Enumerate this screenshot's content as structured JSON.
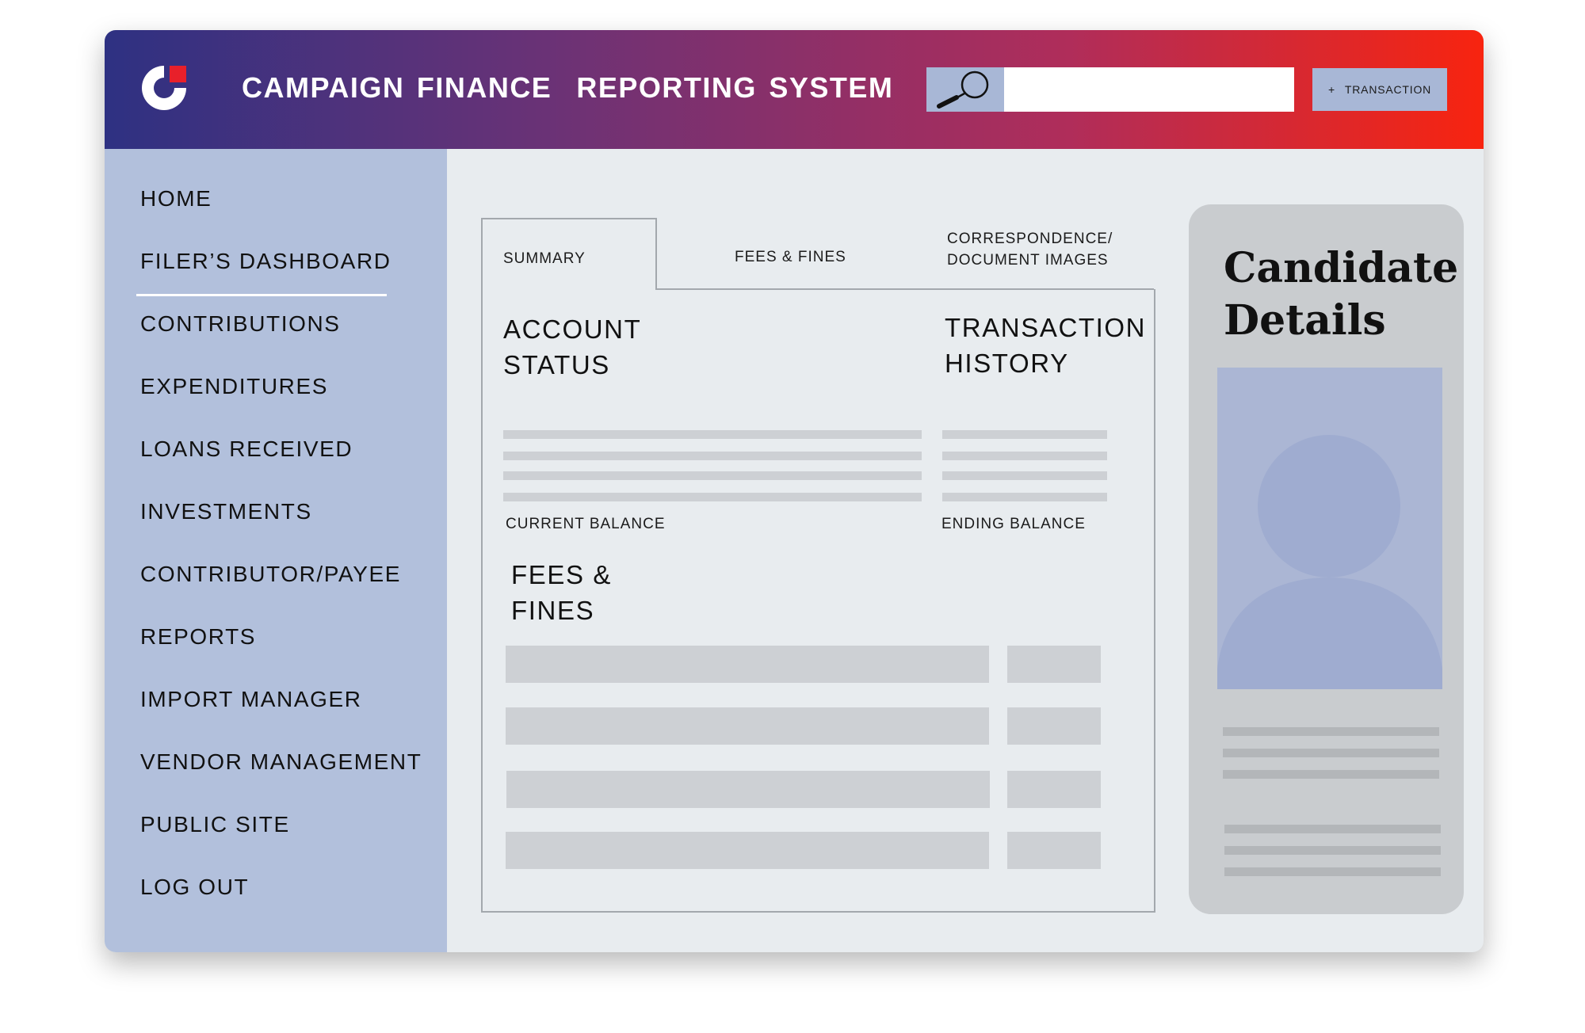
{
  "header": {
    "title": "CAMPAIGN FINANCE  REPORTING SYSTEM",
    "search_value": "",
    "transaction_button": {
      "icon": "+",
      "label": "TRANSACTION"
    }
  },
  "sidebar": {
    "items": [
      {
        "label": "HOME"
      },
      {
        "label": "FILER’S DASHBOARD",
        "active": true
      },
      {
        "label": "CONTRIBUTIONS"
      },
      {
        "label": "EXPENDITURES"
      },
      {
        "label": "LOANS RECEIVED"
      },
      {
        "label": "INVESTMENTS"
      },
      {
        "label": "CONTRIBUTOR/PAYEE"
      },
      {
        "label": "REPORTS"
      },
      {
        "label": "IMPORT MANAGER"
      },
      {
        "label": "VENDOR MANAGEMENT"
      },
      {
        "label": "PUBLIC SITE"
      },
      {
        "label": "LOG OUT"
      }
    ]
  },
  "tabs": [
    {
      "label": "SUMMARY",
      "active": true
    },
    {
      "label": "FEES & FINES"
    },
    {
      "label": "CORRESPONDENCE/\nDOCUMENT IMAGES"
    }
  ],
  "summary": {
    "account_status": {
      "heading": "ACCOUNT\nSTATUS",
      "caption": "CURRENT BALANCE"
    },
    "transaction_history": {
      "heading": "TRANSACTION\nHISTORY",
      "caption": "ENDING BALANCE"
    },
    "fees_fines": {
      "heading": "FEES &\nFINES"
    }
  },
  "candidate": {
    "title": "Candidate\nDetails"
  },
  "colors": {
    "header_gradient": [
      "#2e3182",
      "#6a3276",
      "#b02d5a",
      "#f8240f"
    ],
    "sidebar_bg": "#b2c0dc",
    "main_bg": "#e8ecef",
    "accent_button": "#a8b7d6",
    "logo_red": "#e8202a"
  },
  "icons": {
    "logo": "campaign-logo",
    "search": "magnifier-icon",
    "avatar": "person-silhouette-icon"
  }
}
